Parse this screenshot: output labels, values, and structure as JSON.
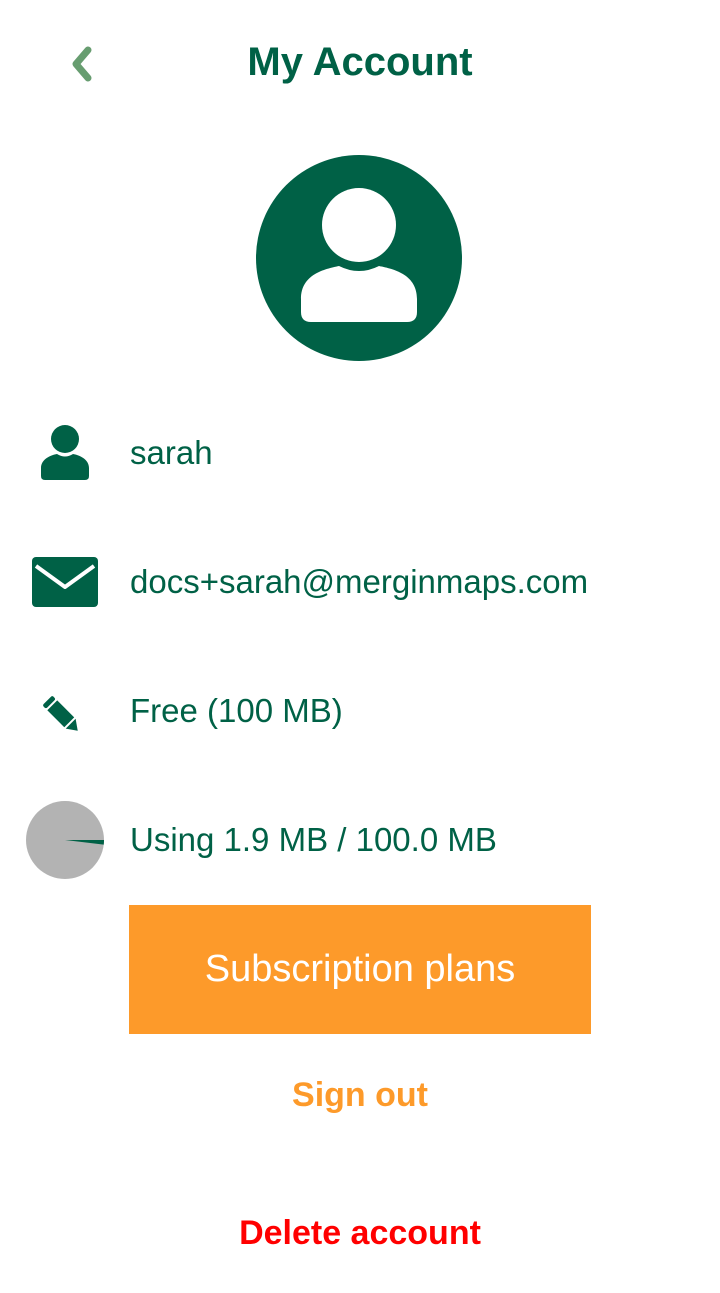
{
  "header": {
    "title": "My Account",
    "back_icon": "chevron-left-icon"
  },
  "profile": {
    "avatar_icon": "user-avatar-icon",
    "username": "sarah",
    "email": "docs+sarah@merginmaps.com",
    "plan": "Free (100 MB)",
    "storage_text": "Using 1.9 MB / 100.0 MB",
    "storage_used_mb": 1.9,
    "storage_total_mb": 100.0
  },
  "actions": {
    "subscription_label": "Subscription plans",
    "sign_out_label": "Sign out",
    "delete_label": "Delete account"
  },
  "colors": {
    "primary": "#006146",
    "accent": "#fd9a2a",
    "danger": "#ff0000",
    "back_arrow": "#679d70",
    "pie_bg": "#b3b3b3"
  }
}
